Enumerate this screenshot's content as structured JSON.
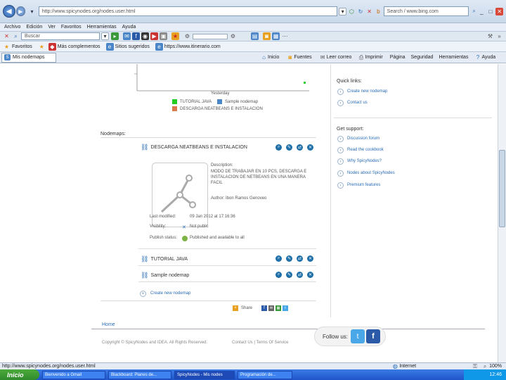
{
  "browser": {
    "address": "http://www.spicynodes.org/nodes.user.html",
    "search_placeholder": "Search / www.bing.com",
    "menu_items": [
      "Archivo",
      "Edición",
      "Ver",
      "Favoritos",
      "Herramientas",
      "Ayuda"
    ],
    "toolbar_search_value": "Buscar",
    "favorites_label": "Favoritos",
    "fav_links": [
      "Más complementos",
      "Sitios sugeridos",
      "https://www.itinerario.com"
    ],
    "tab_label": "Mis nodemaps",
    "cmd_items": [
      "Inicio",
      "Fuentes",
      "Leer correo",
      "Imprimir",
      "Página",
      "Seguridad",
      "Herramientas",
      "Ayuda"
    ]
  },
  "chart": {
    "xlabel": "Yesterday",
    "legend": [
      {
        "label": "TUTORIAL JAVA",
        "color": "#22cc22"
      },
      {
        "label": "Sample nodemap",
        "color": "#4a86c8"
      },
      {
        "label": "DESCARGA NEATBEANS E INSTALACION",
        "color": "#d9784a"
      }
    ]
  },
  "nodemaps": {
    "heading": "Nodemaps:",
    "items": [
      {
        "title": "DESCARGA NEATBEANS E INSTALACION"
      },
      {
        "title": "TUTORIAL JAVA"
      },
      {
        "title": "Sample nodemap"
      }
    ],
    "detail": {
      "desc_label": "Description:",
      "desc_text": "MODO DE TRABAJAR EN 10 PCS, DESCARGA E INSTALACION DE NETBEANS EN UNA MANERA FACIL",
      "author": "Author: Ibon Ramos Genoveo",
      "last_modified_label": "Last modified:",
      "last_modified_value": "09 Jan 2012 at 17:16:36",
      "visibility_label": "Visibility:",
      "visibility_value": "Not public",
      "publish_label": "Publish status:",
      "publish_value": "Published and available to all"
    },
    "create_link": "Create new nodemap",
    "share_label": "Share"
  },
  "sidebar": {
    "quick_heading": "Quick links:",
    "quick_links": [
      "Create new nodemap",
      "Contact us"
    ],
    "support_heading": "Get support:",
    "support_links": [
      "Discussion forum",
      "Read the cookbook",
      "Why SpicyNodes?",
      "Nodes about SpicyNodes",
      "Premium features"
    ]
  },
  "footer": {
    "home": "Home",
    "copyright": "Copyright © SpicyNodes and IDEA. All Rights Reserved.",
    "links": "Contact Us | Terms Of Service",
    "follow": "Follow us:"
  },
  "statusbar": {
    "url": "http://www.spicynodes.org/nodes.user.html",
    "zone": "Internet",
    "zoom": "100%"
  },
  "taskbar": {
    "start": "Inicio",
    "tasks": [
      "Bienvenido a Gmail",
      "Blackboard: Planes de...",
      "SpicyNodes - Mis nodes",
      "Programación de..."
    ],
    "clock": "12:46"
  }
}
